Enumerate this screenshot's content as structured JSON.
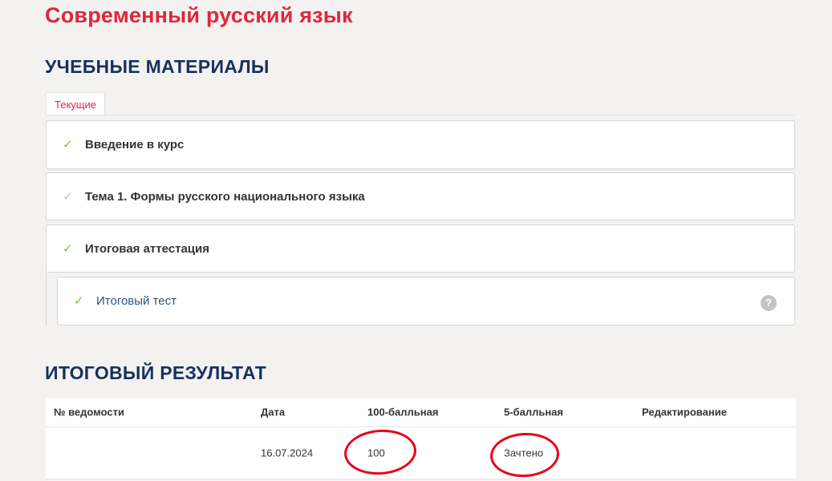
{
  "course": {
    "title": "Современный русский язык"
  },
  "materials": {
    "heading": "УЧЕБНЫЕ МАТЕРИАЛЫ",
    "tab_label": "Текущие",
    "items": [
      {
        "label": "Введение в курс",
        "status": "complete",
        "status_color": "#7cc243"
      },
      {
        "label": "Тема 1. Формы русского национального языка",
        "status": "incomplete",
        "status_color": "#bdbdbd"
      },
      {
        "label": "Итоговая аттестация",
        "status": "complete",
        "status_color": "#7cc243"
      }
    ],
    "sub_items": [
      {
        "label": "Итоговый тест",
        "status": "complete",
        "icon": "help-icon"
      }
    ]
  },
  "results": {
    "heading": "ИТОГОВЫЙ РЕЗУЛЬТАТ",
    "columns": [
      "№ ведомости",
      "Дата",
      "100-балльная",
      "5-балльная",
      "Редактирование"
    ],
    "rows": [
      {
        "sheet_no": "",
        "date": "16.07.2024",
        "score_100": "100",
        "score_5": "Зачтено",
        "edit": ""
      }
    ]
  },
  "annotations": {
    "ellipse_color": "#e6001a",
    "circled": [
      "results.rows.0.score_100",
      "results.rows.0.score_5"
    ]
  },
  "colors": {
    "title": "#e0263e",
    "heading": "#17315e",
    "background": "#f3f2f0",
    "link": "#2a567e"
  }
}
